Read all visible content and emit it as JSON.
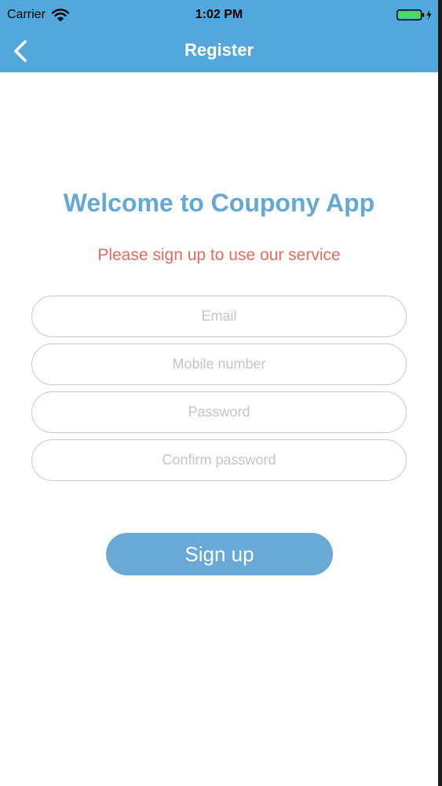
{
  "status_bar": {
    "carrier": "Carrier",
    "time": "1:02 PM",
    "icons": [
      "wifi-icon",
      "battery-icon",
      "charging-bolt-icon"
    ]
  },
  "nav": {
    "title": "Register",
    "back_icon": "chevron-left-icon"
  },
  "content": {
    "welcome": "Welcome to Coupony App",
    "subtitle": "Please sign up to use our service"
  },
  "form": {
    "email": {
      "value": "",
      "placeholder": "Email"
    },
    "mobile": {
      "value": "",
      "placeholder": "Mobile number"
    },
    "password": {
      "value": "",
      "placeholder": "Password"
    },
    "confirm_password": {
      "value": "",
      "placeholder": "Confirm password"
    }
  },
  "actions": {
    "signup_label": "Sign up"
  },
  "colors": {
    "header": "#51a8dc",
    "title": "#64a8d6",
    "subtitle": "#e06c62",
    "button": "#69a9d7",
    "field_border": "#c9c9c9",
    "placeholder": "#c4c4c9"
  }
}
